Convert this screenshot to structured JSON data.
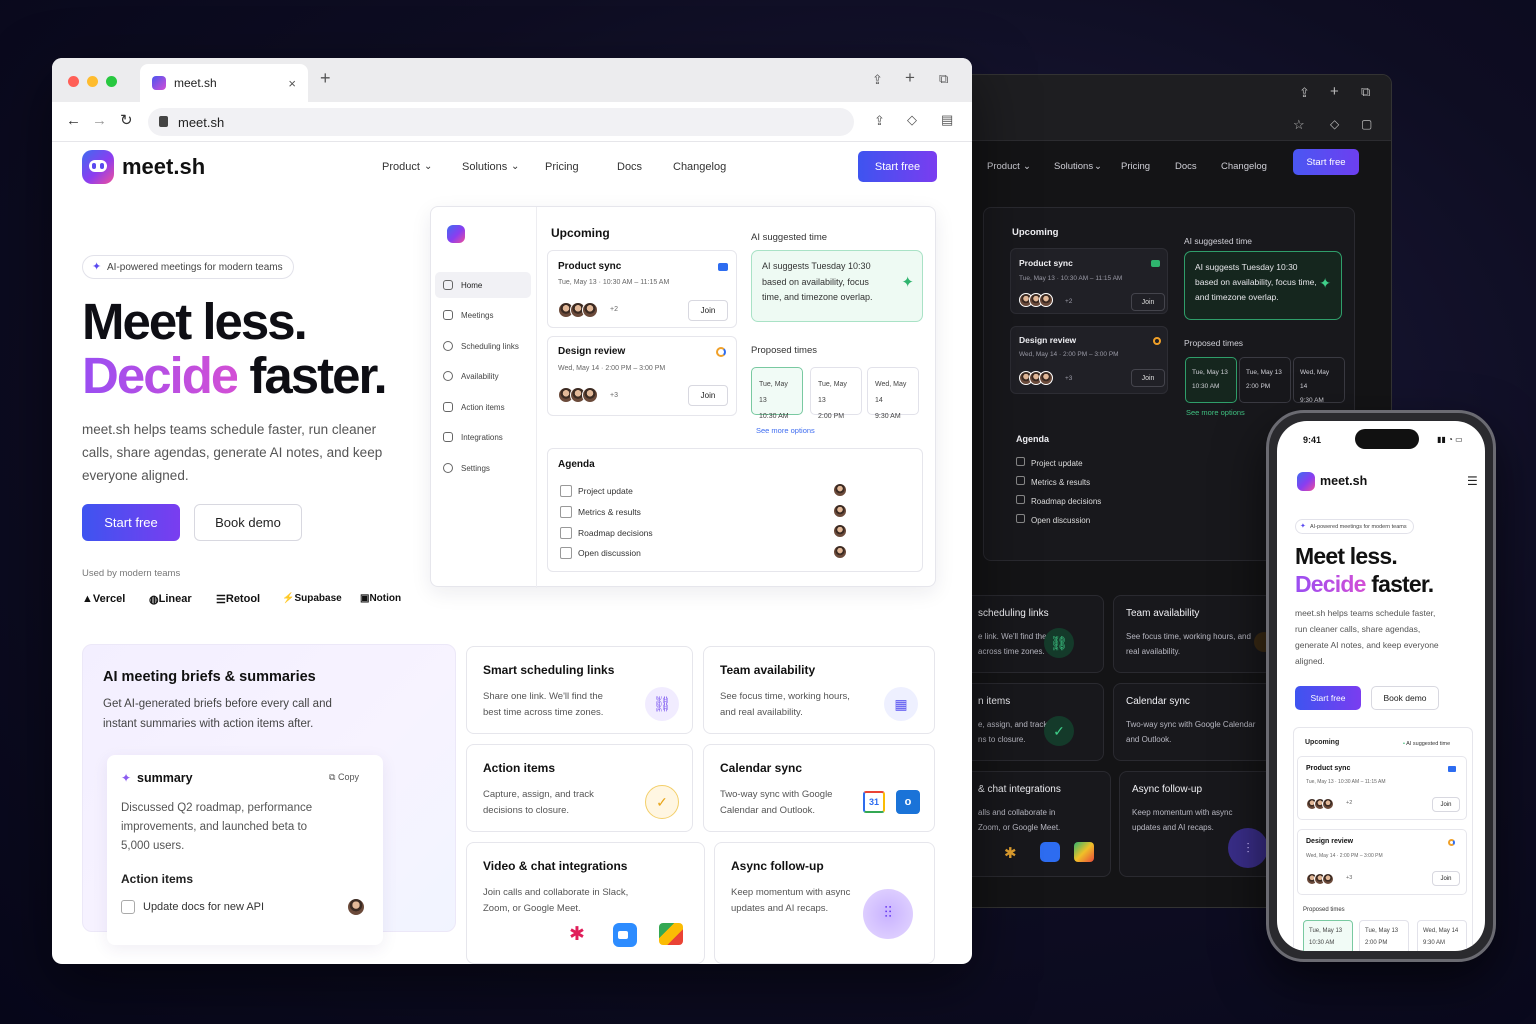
{
  "browser": {
    "tab_title": "meet.sh",
    "url": "meet.sh"
  },
  "brand": {
    "name": "meet.sh",
    "accent": "#4a55f0",
    "accent2": "#7a3df0",
    "ai_green": "#2fb46e"
  },
  "nav": {
    "items": [
      "Product",
      "Solutions",
      "Pricing",
      "Docs",
      "Changelog"
    ],
    "cta": "Start free"
  },
  "hero": {
    "badge": "AI-powered meetings for modern teams",
    "title_line1": "Meet less.",
    "title_line2_grad": "Decide",
    "title_line2_rest": "faster.",
    "lead": "meet.sh helps teams schedule faster, run cleaner calls, share agendas, generate AI notes, and keep everyone aligned.",
    "primary_cta": "Start free",
    "secondary_cta": "Book demo",
    "used_by": "Used by modern teams",
    "logos": [
      "Vercel",
      "Linear",
      "Retool",
      "Supabase",
      "Notion"
    ]
  },
  "app": {
    "sidebar": [
      "Home",
      "Meetings",
      "Scheduling links",
      "Availability",
      "Action items",
      "Integrations",
      "Settings"
    ],
    "upcoming_title": "Upcoming",
    "meetings": [
      {
        "title": "Product sync",
        "time": "Tue, May 13  ·  10:30 AM – 11:15 AM",
        "extra": "+2",
        "join": "Join"
      },
      {
        "title": "Design review",
        "time": "Wed, May 14  ·  2:00 PM – 3:00 PM",
        "extra": "+3",
        "join": "Join"
      }
    ],
    "ai_title": "AI suggested time",
    "ai_text": "AI suggests Tuesday 10:30 based on availability, focus time, and timezone overlap.",
    "proposed_title": "Proposed times",
    "proposed": [
      {
        "day": "Tue, May 13",
        "time": "10:30 AM"
      },
      {
        "day": "Tue, May 13",
        "time": "2:00 PM"
      },
      {
        "day": "Wed, May 14",
        "time": "9:30 AM"
      }
    ],
    "more_options": "See more options",
    "agenda_title": "Agenda",
    "agenda": [
      "Project update",
      "Metrics & results",
      "Roadmap decisions",
      "Open discussion"
    ]
  },
  "brief": {
    "title": "AI meeting briefs & summaries",
    "desc": "Get AI-generated briefs before every call and instant summaries with action items after.",
    "summary_label": "summary",
    "copy": "Copy",
    "summary_text": "Discussed Q2 roadmap, performance improvements, and launched beta to 5,000 users.",
    "action_title": "Action items",
    "action_item": "Update docs for new API"
  },
  "features": [
    {
      "title": "Smart scheduling links",
      "desc": "Share one link. We'll find the best time across time zones."
    },
    {
      "title": "Team availability",
      "desc": "See focus time, working hours, and real availability."
    },
    {
      "title": "Action items",
      "desc": "Capture, assign, and track decisions to closure."
    },
    {
      "title": "Calendar sync",
      "desc": "Two-way sync with Google Calendar and Outlook."
    },
    {
      "title": "Video & chat integrations",
      "desc": "Join calls and collaborate in Slack, Zoom, or Google Meet."
    },
    {
      "title": "Async follow-up",
      "desc": "Keep momentum with async updates and AI recaps."
    }
  ],
  "dark": {
    "f_sched": "scheduling links",
    "f_sched_d": "e link. We'll find the e across time zones.",
    "f_items": "n items",
    "f_items_d": "e, assign, and track ns to closure.",
    "f_chat": "& chat integrations",
    "f_chat_d": "alls and collaborate in Zoom, or Google Meet."
  },
  "phone": {
    "time": "9:41",
    "badge": "AI-powered meetings for modern teams",
    "lead": "meet.sh helps teams schedule faster, run cleaner calls, share agendas, generate AI notes, and keep everyone aligned."
  },
  "calendar_icon_day": "31"
}
